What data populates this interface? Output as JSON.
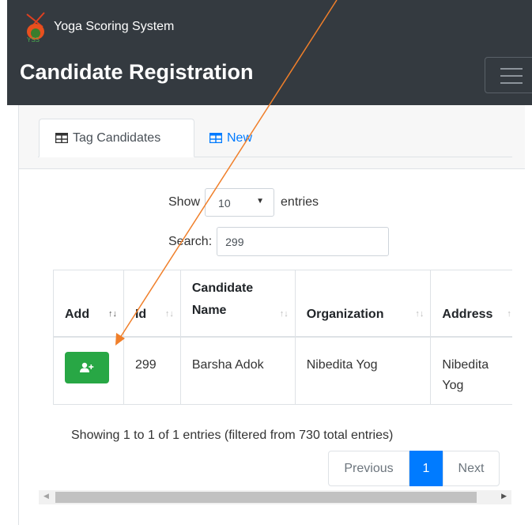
{
  "header": {
    "brand": "Yoga Scoring System",
    "logo_text": "YSS",
    "title": "Candidate Registration"
  },
  "tabs": [
    {
      "label": "Tag Candidates",
      "icon": "table-icon",
      "active": true
    },
    {
      "label": "New",
      "icon": "table-icon",
      "active": false
    }
  ],
  "length": {
    "prefix": "Show",
    "value": "10",
    "suffix": "entries"
  },
  "search": {
    "label": "Search:",
    "value": "299"
  },
  "table": {
    "columns": [
      "Add",
      "Id",
      "Candidate Name",
      "Organization",
      "Address"
    ],
    "rows": [
      {
        "id": "299",
        "name": "Barsha Adok",
        "organization": "Nibedita Yog",
        "address": "Nibedita Yog"
      }
    ]
  },
  "info": "Showing 1 to 1 of 1 entries (filtered from 730 total entries)",
  "pagination": {
    "previous": "Previous",
    "current": "1",
    "next": "Next"
  },
  "colors": {
    "navbar": "#343a40",
    "primary": "#007bff",
    "success": "#28a745",
    "annotation_arrow": "#f07f2a"
  }
}
